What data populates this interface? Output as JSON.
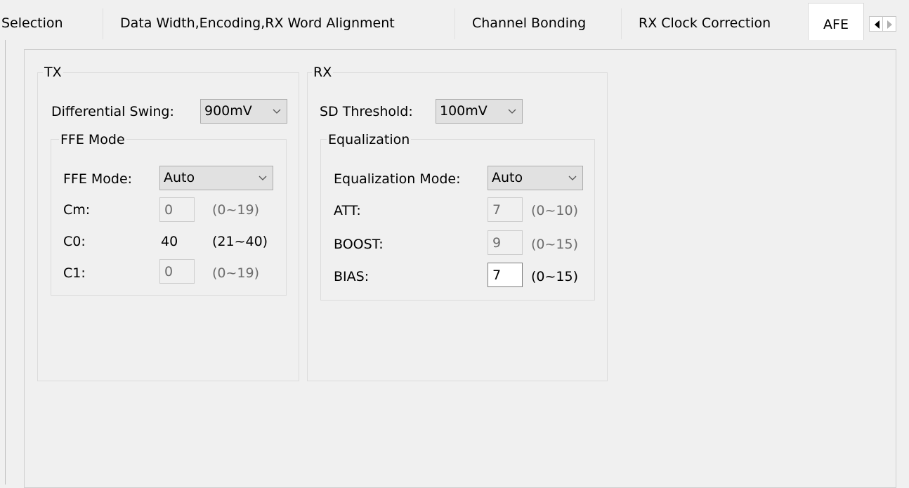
{
  "tabs": [
    {
      "label": "Selection"
    },
    {
      "label": "Data Width,Encoding,RX Word Alignment"
    },
    {
      "label": "Channel Bonding"
    },
    {
      "label": "RX Clock Correction"
    },
    {
      "label": "AFE",
      "selected": true
    }
  ],
  "tab_scroll": {
    "left_icon": "arrow-left-icon",
    "right_icon": "arrow-right-icon"
  },
  "tx": {
    "title": "TX",
    "differential_swing": {
      "label": "Differential Swing:",
      "value": "900mV"
    },
    "ffe": {
      "title": "FFE Mode",
      "mode": {
        "label": "FFE Mode:",
        "value": "Auto"
      },
      "cm": {
        "label": "Cm:",
        "value": "0",
        "range": "(0~19)"
      },
      "c0": {
        "label": "C0:",
        "value": "40",
        "range": "(21~40)"
      },
      "c1": {
        "label": "C1:",
        "value": "0",
        "range": "(0~19)"
      }
    }
  },
  "rx": {
    "title": "RX",
    "sd_threshold": {
      "label": "SD Threshold:",
      "value": "100mV"
    },
    "equalization": {
      "title": "Equalization",
      "mode": {
        "label": "Equalization Mode:",
        "value": "Auto"
      },
      "att": {
        "label": "ATT:",
        "value": "7",
        "range": "(0~10)"
      },
      "boost": {
        "label": "BOOST:",
        "value": "9",
        "range": "(0~15)"
      },
      "bias": {
        "label": "BIAS:",
        "value": "7",
        "range": "(0~15)"
      }
    }
  }
}
